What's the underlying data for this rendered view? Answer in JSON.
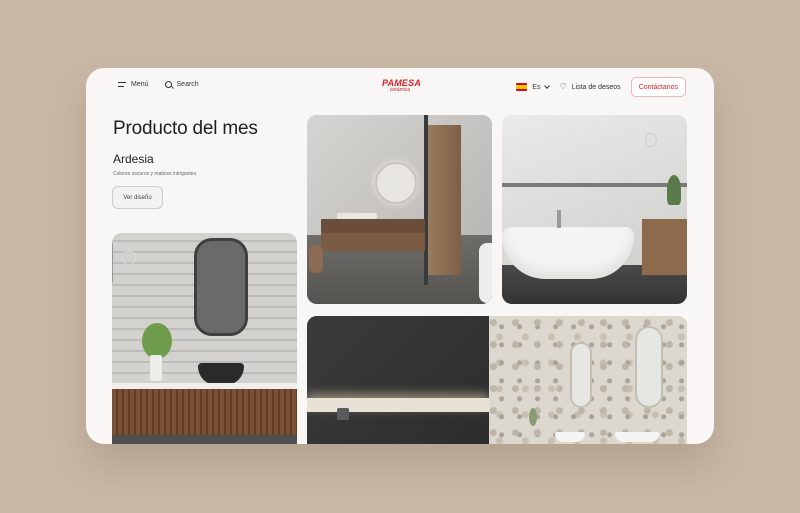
{
  "header": {
    "menu_label": "Menú",
    "search_label": "Search",
    "logo_text": "PAMESA",
    "logo_sub": "cerámica",
    "language": "Es",
    "wishlist_label": "Lista de deseos",
    "contact_label": "Contáctanos"
  },
  "hero": {
    "title": "Producto del mes",
    "product_name": "Ardesia",
    "description": "Colores oscuros y matices intrigantes.",
    "button_label": "Ver diseño"
  },
  "colors": {
    "brand": "#e0202a",
    "backdrop": "#c9b8a5",
    "panel": "#f8f7f5"
  }
}
